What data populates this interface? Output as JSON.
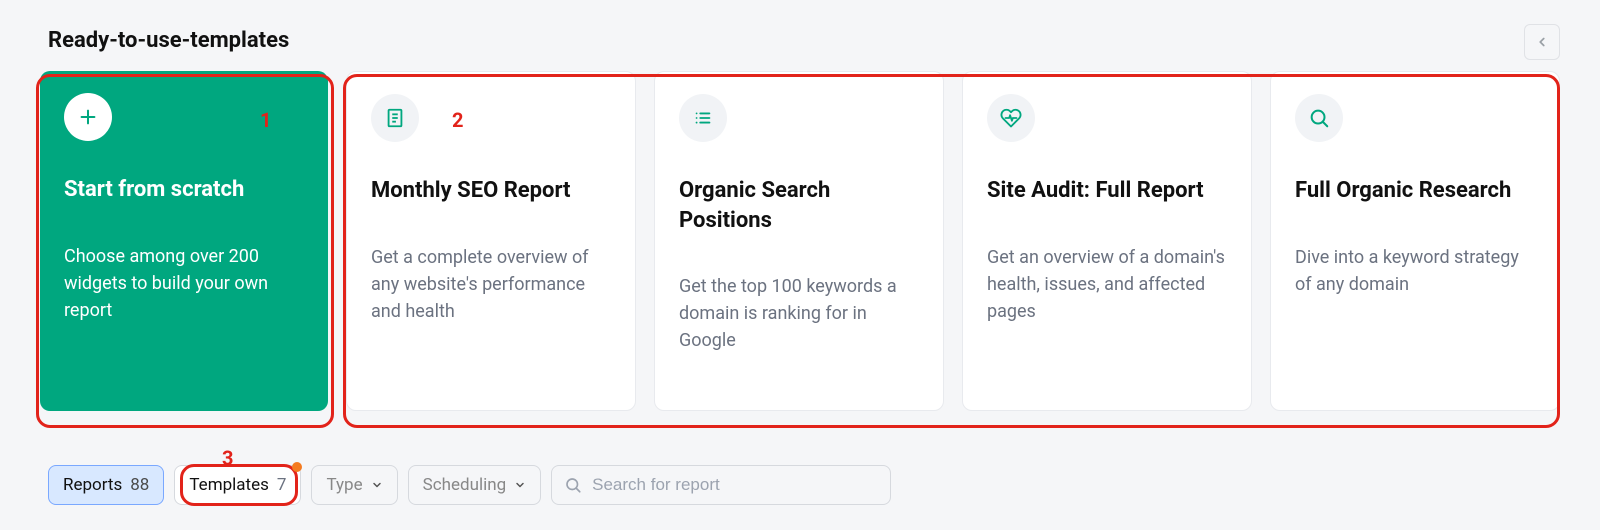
{
  "section_title": "Ready-to-use-templates",
  "annotations": {
    "n1": "1",
    "n2": "2",
    "n3": "3"
  },
  "cards": [
    {
      "title": "Start from scratch",
      "desc": "Choose among over 200 widgets to build your own report"
    },
    {
      "title": "Monthly SEO Report",
      "desc": "Get a complete overview of any website's performance and health"
    },
    {
      "title": "Organic Search Positions",
      "desc": "Get the top 100 keywords a domain is ranking for in Google"
    },
    {
      "title": "Site Audit: Full Report",
      "desc": "Get an overview of a domain's health, issues, and affected pages"
    },
    {
      "title": "Full Organic Research",
      "desc": "Dive into a keyword strategy of any domain"
    }
  ],
  "filters": {
    "reports_label": "Reports",
    "reports_count": "88",
    "templates_label": "Templates",
    "templates_count": "7",
    "type_label": "Type",
    "scheduling_label": "Scheduling",
    "search_placeholder": "Search for report"
  },
  "colors": {
    "accent_green": "#00a77f"
  }
}
